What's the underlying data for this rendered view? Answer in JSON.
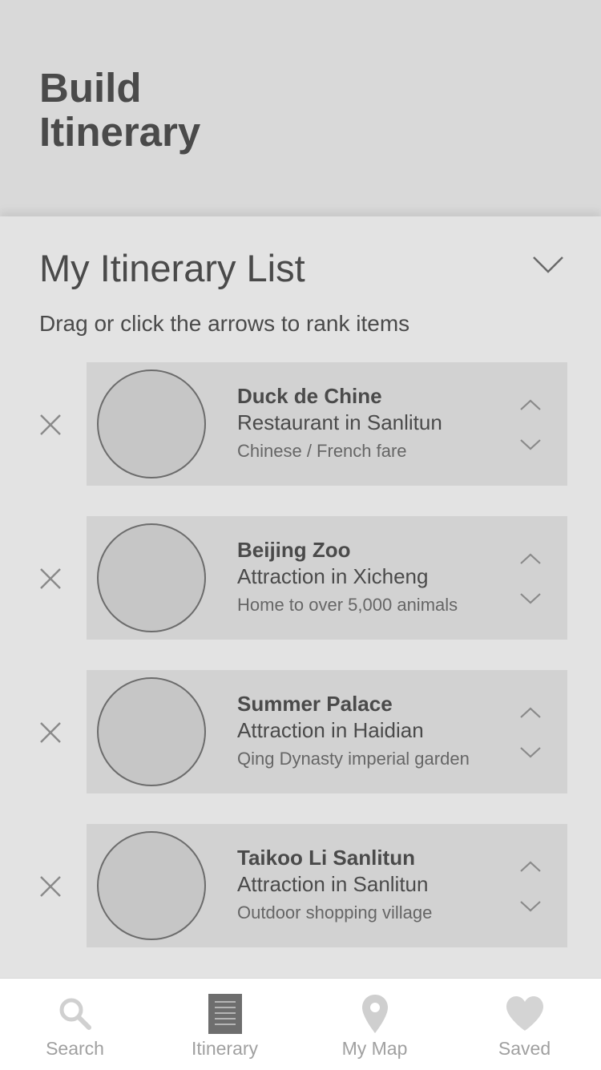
{
  "header": {
    "title": "Build\nItinerary"
  },
  "list": {
    "title": "My Itinerary List",
    "instructions": "Drag or click the arrows to rank items",
    "collapse_icon": "chevron-down-icon",
    "items": [
      {
        "name": "Duck de Chine",
        "type": "Restaurant in Sanlitun",
        "description": "Chinese / French fare"
      },
      {
        "name": "Beijing Zoo",
        "type": "Attraction in Xicheng",
        "description": "Home to over 5,000 animals"
      },
      {
        "name": "Summer Palace",
        "type": "Attraction in Haidian",
        "description": "Qing Dynasty imperial garden"
      },
      {
        "name": "Taikoo Li Sanlitun",
        "type": "Attraction in Sanlitun",
        "description": "Outdoor shopping village"
      }
    ]
  },
  "tabbar": {
    "tabs": [
      {
        "label": "Search",
        "icon": "search-icon",
        "active": false
      },
      {
        "label": "Itinerary",
        "icon": "list-icon",
        "active": true
      },
      {
        "label": "My Map",
        "icon": "map-pin-icon",
        "active": false
      },
      {
        "label": "Saved",
        "icon": "heart-icon",
        "active": false
      }
    ]
  },
  "colors": {
    "header_bg": "#d9d9d9",
    "panel_bg": "#e3e3e3",
    "card_bg": "#d2d2d2",
    "text_dark": "#4a4a4a",
    "tab_inactive": "#a0a0a0",
    "tab_active": "#6e6e6e"
  }
}
